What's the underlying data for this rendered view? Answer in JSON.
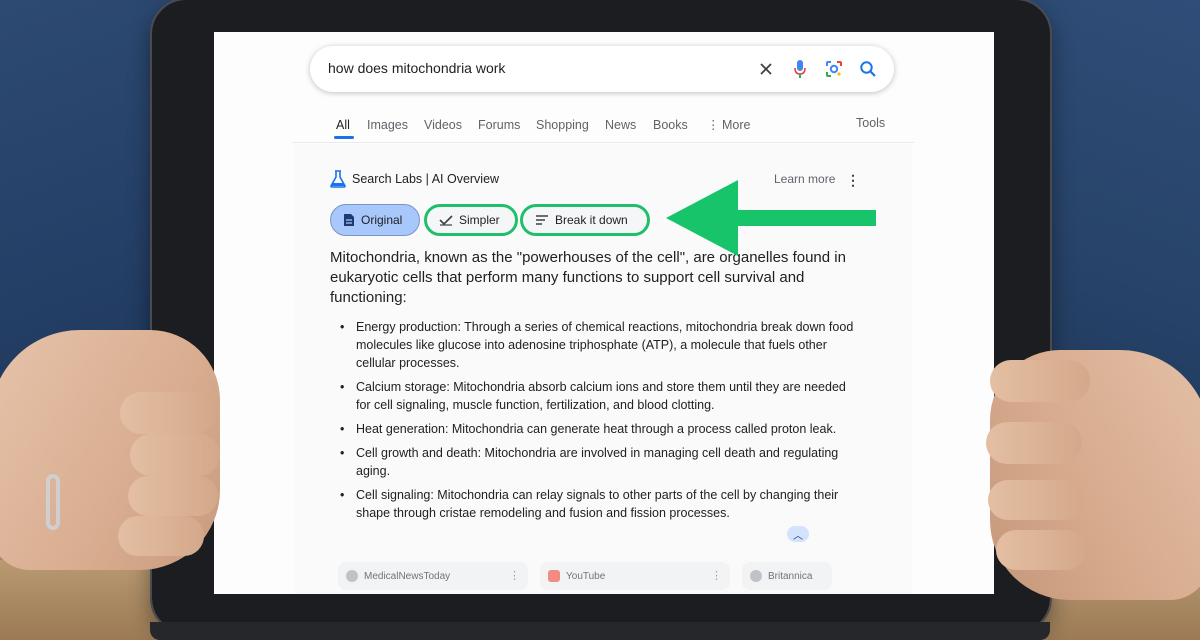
{
  "search": {
    "query": "how does mitochondria work"
  },
  "tabs": {
    "all": "All",
    "images": "Images",
    "videos": "Videos",
    "forums": "Forums",
    "shopping": "Shopping",
    "news": "News",
    "books": "Books",
    "more": "More",
    "tools": "Tools"
  },
  "ai_overview": {
    "header": "Search Labs | AI Overview",
    "learn_more": "Learn more",
    "chips": {
      "original": "Original",
      "simpler": "Simpler",
      "breakdown": "Break it down"
    },
    "intro": "Mitochondria, known as the \"powerhouses of the cell\", are organelles found in eukaryotic cells that perform many functions to support cell survival and functioning:",
    "bullets": [
      "Energy production: Through a series of chemical reactions, mitochondria break down food molecules like glucose into adenosine triphosphate (ATP), a molecule that fuels other cellular processes.",
      "Calcium storage: Mitochondria absorb calcium ions and store them until they are needed for cell signaling, muscle function, fertilization, and blood clotting.",
      "Heat generation: Mitochondria can generate heat through a process called proton leak.",
      "Cell growth and death: Mitochondria are involved in managing cell death and regulating aging.",
      "Cell signaling: Mitochondria can relay signals to other parts of the cell by changing their shape through cristae remodeling and fusion and fission processes."
    ],
    "sources": [
      "MedicalNewsToday",
      "YouTube",
      "Britannica"
    ]
  },
  "colors": {
    "accent_blue": "#1a73e8",
    "chip_selected": "#a8c7fa",
    "highlight_green": "#17c46a"
  }
}
